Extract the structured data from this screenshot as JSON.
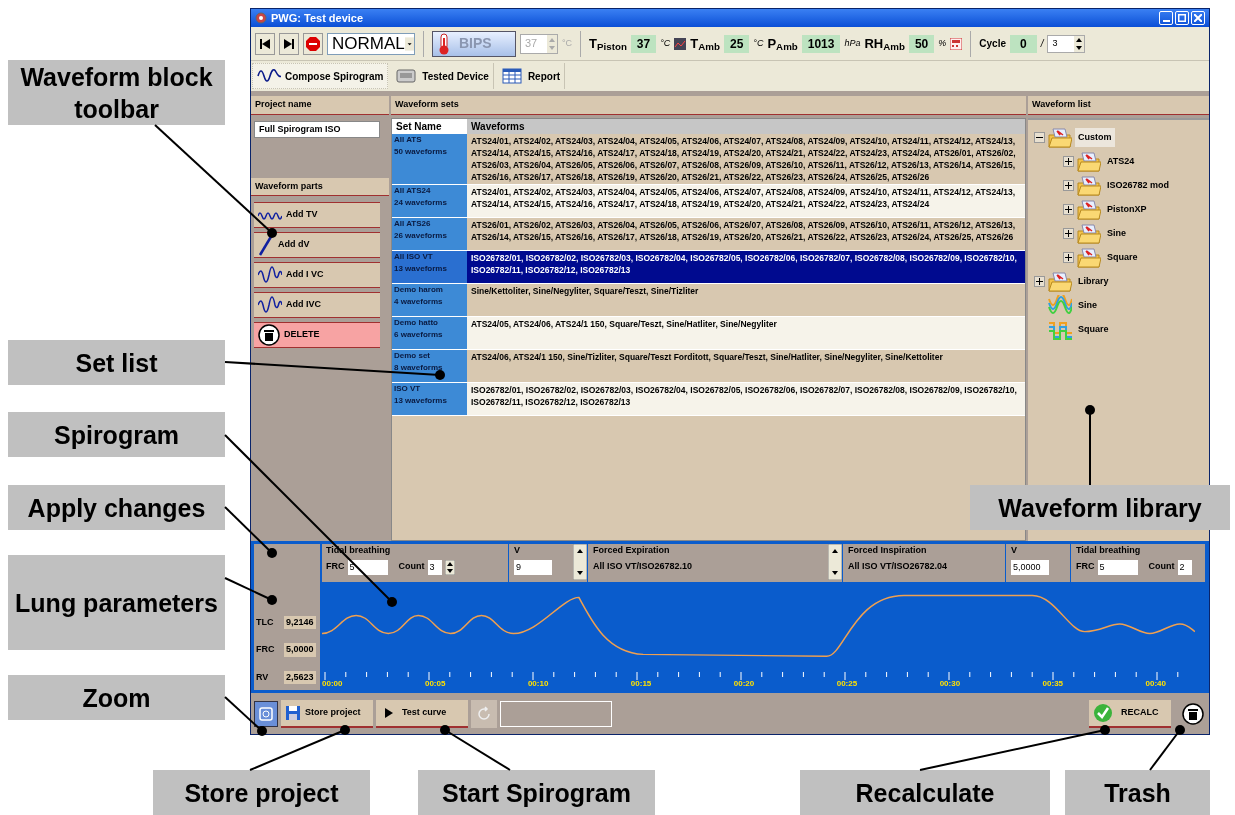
{
  "window": {
    "title": "PWG: Test device"
  },
  "toolbar": {
    "mode": "NORMAL",
    "bips_label": "BIPS",
    "bips_value": "37",
    "bips_unit": "°C",
    "readings": [
      {
        "label": "T$_{Piston}$",
        "value": "37",
        "unit": "°C",
        "kind": "chart"
      },
      {
        "label": "T$_{Amb}$",
        "value": "25",
        "unit": "°C",
        "kind": "plain"
      },
      {
        "label": "P$_{Amb}$",
        "value": "1013",
        "unit": "hPa",
        "kind": "plain"
      },
      {
        "label": "RH$_{Amb}$",
        "value": "50",
        "unit": "%",
        "kind": "calc"
      }
    ],
    "cycle": {
      "label": "Cycle",
      "value": "0",
      "separator": "/",
      "total": "3"
    }
  },
  "tabs": [
    {
      "label": "Compose Spirogram",
      "selected": true,
      "kind": "wave"
    },
    {
      "label": "Tested Device",
      "selected": false,
      "kind": "device"
    },
    {
      "label": "Report",
      "selected": false,
      "kind": "report"
    }
  ],
  "project": {
    "header": "Project name",
    "name": "Full Spirogram ISO"
  },
  "waveform_parts": {
    "header": "Waveform parts",
    "buttons": [
      {
        "label": "Add TV",
        "kind": "tv"
      },
      {
        "label": "Add dV",
        "kind": "dv"
      },
      {
        "label": "Add I VC",
        "kind": "ivc"
      },
      {
        "label": "Add IVC",
        "kind": "ivc"
      },
      {
        "label": "DELETE",
        "kind": "delete"
      }
    ]
  },
  "waveform_sets": {
    "header": "Waveform sets",
    "columns": [
      "Set Name",
      "Waveforms"
    ],
    "rows": [
      {
        "name": "All ATS",
        "count": "50 waveforms",
        "selected": false,
        "waveforms": "ATS24/01, ATS24/02, ATS24/03, ATS24/04, ATS24/05, ATS24/06, ATS24/07, ATS24/08, ATS24/09, ATS24/10, ATS24/11, ATS24/12, ATS24/13, ATS24/14, ATS24/15, ATS24/16, ATS24/17, ATS24/18, ATS24/19, ATS24/20, ATS24/21, ATS24/22, ATS24/23, ATS24/24, ATS26/01, ATS26/02, ATS26/03, ATS26/04, ATS26/05, ATS26/06, ATS26/07, ATS26/08, ATS26/09, ATS26/10, ATS26/11, ATS26/12, ATS26/13, ATS26/14, ATS26/15, ATS26/16, ATS26/17, ATS26/18, ATS26/19, ATS26/20, ATS26/21, ATS26/22, ATS26/23, ATS26/24, ATS26/25, ATS26/26"
      },
      {
        "name": "All ATS24",
        "count": "24 waveforms",
        "selected": false,
        "waveforms": "ATS24/01, ATS24/02, ATS24/03, ATS24/04, ATS24/05, ATS24/06, ATS24/07, ATS24/08, ATS24/09, ATS24/10, ATS24/11, ATS24/12, ATS24/13, ATS24/14, ATS24/15, ATS24/16, ATS24/17, ATS24/18, ATS24/19, ATS24/20, ATS24/21, ATS24/22, ATS24/23, ATS24/24"
      },
      {
        "name": "All ATS26",
        "count": "26 waveforms",
        "selected": false,
        "waveforms": "ATS26/01, ATS26/02, ATS26/03, ATS26/04, ATS26/05, ATS26/06, ATS26/07, ATS26/08, ATS26/09, ATS26/10, ATS26/11, ATS26/12, ATS26/13, ATS26/14, ATS26/15, ATS26/16, ATS26/17, ATS26/18, ATS26/19, ATS26/20, ATS26/21, ATS26/22, ATS26/23, ATS26/24, ATS26/25, ATS26/26"
      },
      {
        "name": "All ISO VT",
        "count": "13 waveforms",
        "selected": true,
        "waveforms": "ISO26782/01, ISO26782/02, ISO26782/03, ISO26782/04, ISO26782/05, ISO26782/06, ISO26782/07, ISO26782/08, ISO26782/09, ISO26782/10, ISO26782/11, ISO26782/12, ISO26782/13"
      },
      {
        "name": "Demo harom",
        "count": "4 waveforms",
        "selected": false,
        "waveforms": "Sine/Kettoliter, Sine/Negyliter, Square/Teszt, Sine/Tizliter"
      },
      {
        "name": "Demo hatto",
        "count": "6 waveforms",
        "selected": false,
        "waveforms": "ATS24/05, ATS24/06, ATS24/1 150, Square/Teszt, Sine/Hatliter, Sine/Negyliter"
      },
      {
        "name": "Demo set",
        "count": "8 waveforms",
        "selected": false,
        "waveforms": "ATS24/06, ATS24/1 150, Sine/Tizliter, Square/Teszt Forditott, Square/Teszt, Sine/Hatliter, Sine/Negyliter, Sine/Kettoliter"
      },
      {
        "name": "ISO VT",
        "count": "13 waveforms",
        "selected": false,
        "waveforms": "ISO26782/01, ISO26782/02, ISO26782/03, ISO26782/04, ISO26782/05, ISO26782/06, ISO26782/07, ISO26782/08, ISO26782/09, ISO26782/10, ISO26782/11, ISO26782/12, ISO26782/13"
      }
    ]
  },
  "waveform_list": {
    "header": "Waveform list",
    "tree": [
      {
        "label": "Custom",
        "kind": "folder",
        "expanded": true,
        "selected": true,
        "children": [
          {
            "label": "ATS24",
            "kind": "folder",
            "expanded": false,
            "selected": false
          },
          {
            "label": "ISO26782 mod",
            "kind": "folder",
            "expanded": false,
            "selected": false
          },
          {
            "label": "PistonXP",
            "kind": "folder",
            "expanded": false,
            "selected": false
          },
          {
            "label": "Sine",
            "kind": "folder",
            "expanded": false,
            "selected": false
          },
          {
            "label": "Square",
            "kind": "folder",
            "expanded": false,
            "selected": false
          }
        ]
      },
      {
        "label": "Library",
        "kind": "folder",
        "expanded": false,
        "selected": false
      },
      {
        "label": "Sine",
        "kind": "sine",
        "selected": false
      },
      {
        "label": "Square",
        "kind": "square",
        "selected": false
      }
    ]
  },
  "segments": [
    {
      "kind": "tidal",
      "title": "Tidal breathing",
      "frc_label": "FRC",
      "frc": "5",
      "count_label": "Count",
      "count": "3",
      "spinner": true
    },
    {
      "kind": "volume",
      "title": "V",
      "value": "9",
      "scroll": true
    },
    {
      "kind": "forced",
      "title": "Forced Expiration",
      "value": "All ISO VT/ISO26782.10",
      "scroll": true
    },
    {
      "kind": "forced",
      "title": "Forced Inspiration",
      "value": "All ISO VT/ISO26782.04",
      "scroll": false
    },
    {
      "kind": "volume",
      "title": "V",
      "value": "5,0000",
      "scroll": false
    },
    {
      "kind": "tidal",
      "title": "Tidal breathing",
      "frc_label": "FRC",
      "frc": "5",
      "count_label": "Count",
      "count": "2",
      "spinner": false
    }
  ],
  "lung_parameters": [
    {
      "label": "TLC",
      "value": "9,2146"
    },
    {
      "label": "FRC",
      "value": "5,0000"
    },
    {
      "label": "RV",
      "value": "2,5623"
    }
  ],
  "time_axis": [
    "00:00",
    "00:05",
    "00:10",
    "00:15",
    "00:20",
    "00:25",
    "00:30",
    "00:35",
    "00:40"
  ],
  "bottom_bar": {
    "store": "Store project",
    "test": "Test curve",
    "recalc": "RECALC"
  },
  "callouts": [
    "Waveform block toolbar",
    "Set list",
    "Spirogram",
    "Apply changes",
    "Lung parameters",
    "Zoom",
    "Store project",
    "Start Spirogram",
    "Recalculate",
    "Trash",
    "Waveform library"
  ]
}
